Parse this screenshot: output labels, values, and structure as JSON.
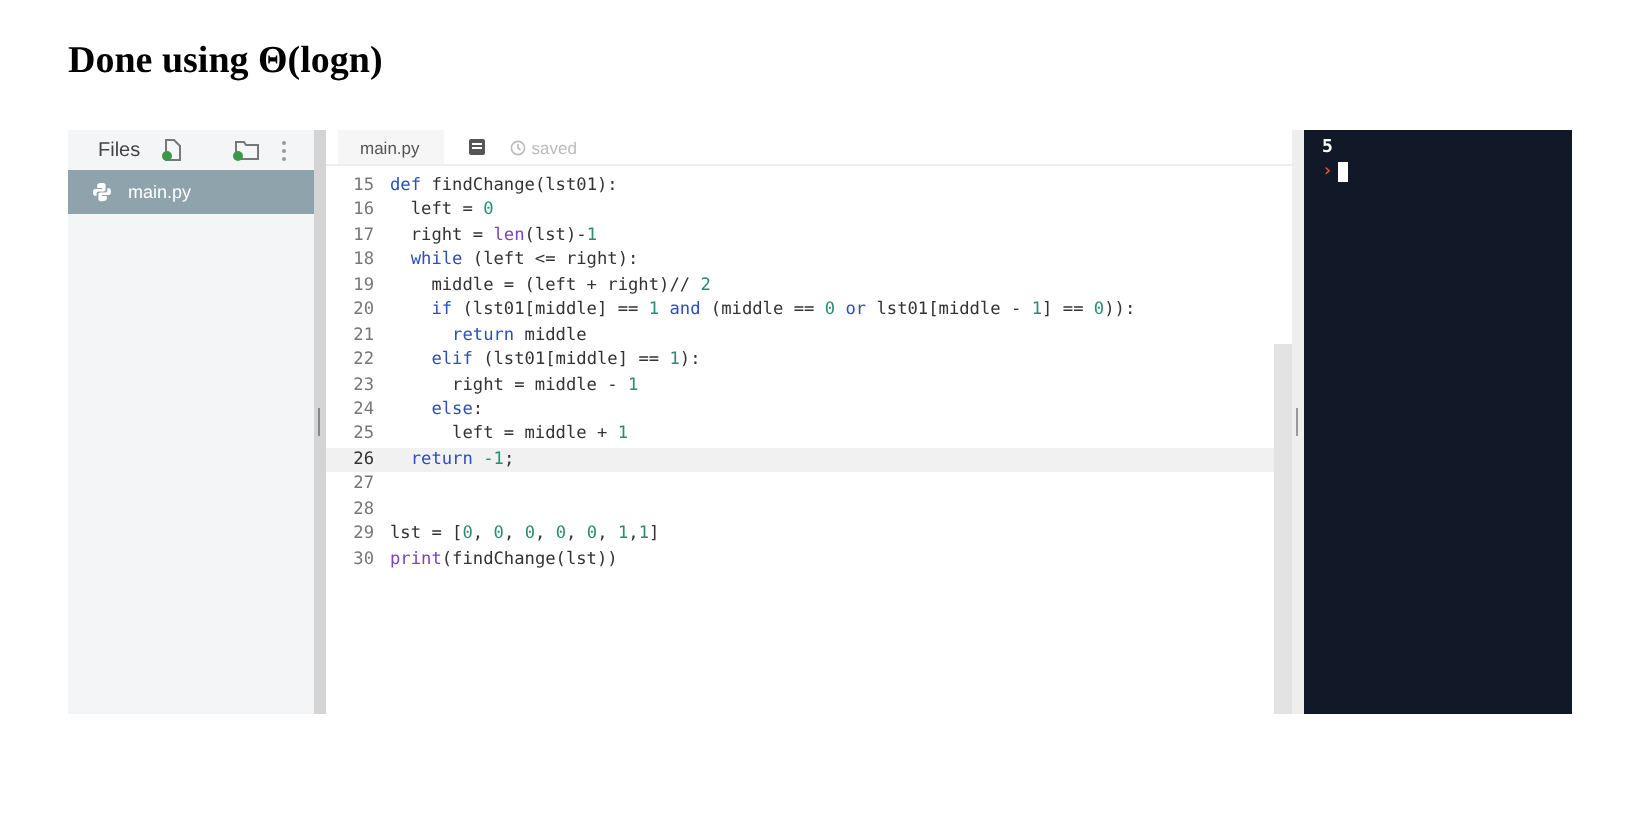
{
  "heading": "Done using Θ(logn)",
  "sidebar": {
    "title": "Files",
    "files": [
      {
        "name": "main.py",
        "selected": true
      }
    ]
  },
  "editor": {
    "tab": "main.py",
    "status": "saved",
    "lines": [
      {
        "number": "15",
        "active": false,
        "tokens": [
          {
            "kind": "kw",
            "text": "def"
          },
          {
            "kind": "plain",
            "text": " findChange(lst01):"
          }
        ]
      },
      {
        "number": "16",
        "active": false,
        "tokens": [
          {
            "kind": "plain",
            "text": "  left = "
          },
          {
            "kind": "num",
            "text": "0"
          }
        ]
      },
      {
        "number": "17",
        "active": false,
        "tokens": [
          {
            "kind": "plain",
            "text": "  right = "
          },
          {
            "kind": "fn",
            "text": "len"
          },
          {
            "kind": "plain",
            "text": "(lst)-"
          },
          {
            "kind": "num",
            "text": "1"
          }
        ]
      },
      {
        "number": "18",
        "active": false,
        "tokens": [
          {
            "kind": "kw",
            "text": "  while"
          },
          {
            "kind": "plain",
            "text": " (left <= right):"
          }
        ]
      },
      {
        "number": "19",
        "active": false,
        "tokens": [
          {
            "kind": "plain",
            "text": "    middle = (left + right)// "
          },
          {
            "kind": "num",
            "text": "2"
          }
        ]
      },
      {
        "number": "20",
        "active": false,
        "tokens": [
          {
            "kind": "kw",
            "text": "    if"
          },
          {
            "kind": "plain",
            "text": " (lst01[middle] == "
          },
          {
            "kind": "num",
            "text": "1"
          },
          {
            "kind": "kw",
            "text": " and"
          },
          {
            "kind": "plain",
            "text": " (middle == "
          },
          {
            "kind": "num",
            "text": "0"
          },
          {
            "kind": "kw",
            "text": " or"
          },
          {
            "kind": "plain",
            "text": " lst01[middle - "
          },
          {
            "kind": "num",
            "text": "1"
          },
          {
            "kind": "plain",
            "text": "] == "
          },
          {
            "kind": "num",
            "text": "0"
          },
          {
            "kind": "plain",
            "text": ")):"
          }
        ]
      },
      {
        "number": "21",
        "active": false,
        "tokens": [
          {
            "kind": "kw",
            "text": "      return"
          },
          {
            "kind": "plain",
            "text": " middle"
          }
        ]
      },
      {
        "number": "22",
        "active": false,
        "tokens": [
          {
            "kind": "kw",
            "text": "    elif"
          },
          {
            "kind": "plain",
            "text": " (lst01[middle] == "
          },
          {
            "kind": "num",
            "text": "1"
          },
          {
            "kind": "plain",
            "text": "):"
          }
        ]
      },
      {
        "number": "23",
        "active": false,
        "tokens": [
          {
            "kind": "plain",
            "text": "      right = middle - "
          },
          {
            "kind": "num",
            "text": "1"
          }
        ]
      },
      {
        "number": "24",
        "active": false,
        "tokens": [
          {
            "kind": "kw",
            "text": "    else"
          },
          {
            "kind": "plain",
            "text": ":"
          }
        ]
      },
      {
        "number": "25",
        "active": false,
        "tokens": [
          {
            "kind": "plain",
            "text": "      left = middle + "
          },
          {
            "kind": "num",
            "text": "1"
          }
        ]
      },
      {
        "number": "26",
        "active": true,
        "tokens": [
          {
            "kind": "kw",
            "text": "  return"
          },
          {
            "kind": "num",
            "text": " -1"
          },
          {
            "kind": "plain",
            "text": ";"
          }
        ]
      },
      {
        "number": "27",
        "active": false
      },
      {
        "number": "28",
        "active": false
      },
      {
        "number": "29",
        "active": false,
        "tokens": [
          {
            "kind": "plain",
            "text": "lst = ["
          },
          {
            "kind": "num",
            "text": "0"
          },
          {
            "kind": "plain",
            "text": ", "
          },
          {
            "kind": "num",
            "text": "0"
          },
          {
            "kind": "plain",
            "text": ", "
          },
          {
            "kind": "num",
            "text": "0"
          },
          {
            "kind": "plain",
            "text": ", "
          },
          {
            "kind": "num",
            "text": "0"
          },
          {
            "kind": "plain",
            "text": ", "
          },
          {
            "kind": "num",
            "text": "0"
          },
          {
            "kind": "plain",
            "text": ", "
          },
          {
            "kind": "num",
            "text": "1"
          },
          {
            "kind": "plain",
            "text": ","
          },
          {
            "kind": "num",
            "text": "1"
          },
          {
            "kind": "plain",
            "text": "]"
          }
        ]
      },
      {
        "number": "30",
        "active": false,
        "tokens": [
          {
            "kind": "fn",
            "text": "print"
          },
          {
            "kind": "plain",
            "text": "(findChange(lst))"
          }
        ]
      }
    ]
  },
  "console": {
    "output": [
      "5"
    ],
    "prompt": "›"
  }
}
